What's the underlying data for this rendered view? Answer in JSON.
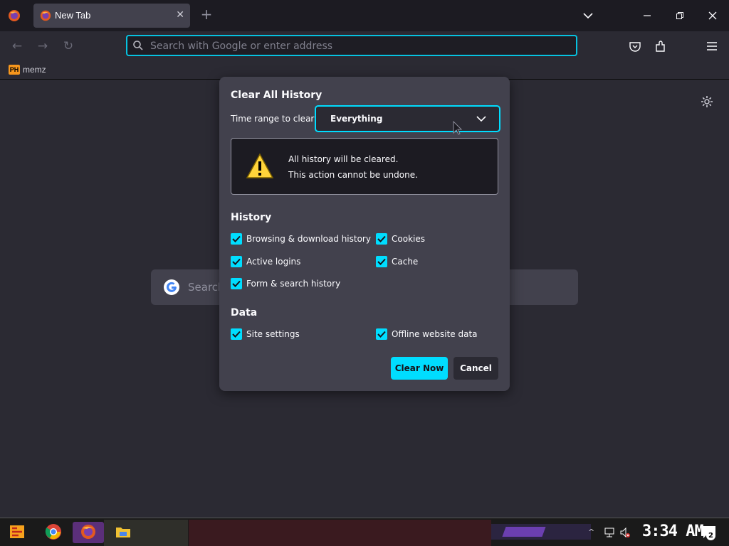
{
  "browser": {
    "tab": {
      "title": "New Tab"
    },
    "urlbar": {
      "placeholder": "Search with Google or enter address"
    },
    "bookmarks": [
      {
        "label": "memz",
        "favicon_text": "PH"
      }
    ]
  },
  "newtab": {
    "search_placeholder": "Search"
  },
  "dialog": {
    "title": "Clear All History",
    "time_range_label": "Time range to clear:",
    "time_range_value": "Everything",
    "warning": {
      "line1": "All history will be cleared.",
      "line2": "This action cannot be undone."
    },
    "history_section": {
      "title": "History",
      "items": [
        {
          "label": "Browsing & download history",
          "checked": true
        },
        {
          "label": "Cookies",
          "checked": true
        },
        {
          "label": "Active logins",
          "checked": true
        },
        {
          "label": "Cache",
          "checked": true
        },
        {
          "label": "Form & search history",
          "checked": true
        }
      ]
    },
    "data_section": {
      "title": "Data",
      "items": [
        {
          "label": "Site settings",
          "checked": true
        },
        {
          "label": "Offline website data",
          "checked": true
        }
      ]
    },
    "buttons": {
      "clear": "Clear Now",
      "cancel": "Cancel"
    }
  },
  "taskbar": {
    "clock": "3:34 AM",
    "notification_count": "2"
  },
  "colors": {
    "accent": "#00ddff",
    "dialog_bg": "#42414d",
    "page_bg": "#2b2a33"
  }
}
